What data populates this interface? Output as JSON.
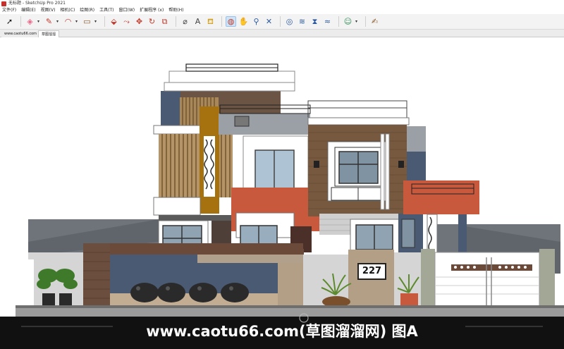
{
  "window": {
    "title": "无标题 - SketchUp Pro 2021"
  },
  "menu": {
    "items": [
      "文件(F)",
      "编辑(E)",
      "视图(V)",
      "相机(C)",
      "绘图(R)",
      "工具(T)",
      "窗口(W)",
      "扩展程序 (x)",
      "帮助(H)"
    ]
  },
  "toolbar": {
    "tools": [
      {
        "name": "select-icon",
        "glyph": "➚",
        "color": "#111111"
      },
      {
        "name": "eraser-icon",
        "glyph": "◈",
        "color": "#e86a8a"
      },
      {
        "name": "line-icon",
        "glyph": "✎",
        "color": "#c0392b"
      },
      {
        "name": "arc-icon",
        "glyph": "◠",
        "color": "#c0392b"
      },
      {
        "name": "rectangle-icon",
        "glyph": "▭",
        "color": "#8b5a2b"
      },
      {
        "name": "pushpull-icon",
        "glyph": "⬙",
        "color": "#c0392b"
      },
      {
        "name": "followme-icon",
        "glyph": "⤳",
        "color": "#c0392b"
      },
      {
        "name": "move-icon",
        "glyph": "✥",
        "color": "#c0392b"
      },
      {
        "name": "rotate-icon",
        "glyph": "↻",
        "color": "#c0392b"
      },
      {
        "name": "scale-icon",
        "glyph": "⧉",
        "color": "#c0392b"
      },
      {
        "name": "tape-measure-icon",
        "glyph": "⌀",
        "color": "#444444"
      },
      {
        "name": "text-icon",
        "glyph": "A",
        "color": "#444444"
      },
      {
        "name": "paint-bucket-icon",
        "glyph": "⛾",
        "color": "#d4a017"
      },
      {
        "name": "orbit-icon",
        "glyph": "◍",
        "color": "#c0392b"
      },
      {
        "name": "pan-icon",
        "glyph": "✋",
        "color": "#d4a017"
      },
      {
        "name": "zoom-icon",
        "glyph": "⚲",
        "color": "#2c5aa0"
      },
      {
        "name": "zoom-extents-icon",
        "glyph": "✕",
        "color": "#2c5aa0"
      },
      {
        "name": "warehouse-icon",
        "glyph": "◎",
        "color": "#2c5aa0"
      },
      {
        "name": "extension-warehouse-icon",
        "glyph": "≋",
        "color": "#2c5aa0"
      },
      {
        "name": "layout-icon",
        "glyph": "⧗",
        "color": "#2c5aa0"
      },
      {
        "name": "styles-icon",
        "glyph": "≈",
        "color": "#2c5aa0"
      },
      {
        "name": "account-icon",
        "glyph": "☺",
        "color": "#2e8b57"
      },
      {
        "name": "scene-note-icon",
        "glyph": "✍",
        "color": "#8b5a2b"
      }
    ]
  },
  "tabs": [
    {
      "label": "www.caotu66.com"
    },
    {
      "label": "草图溜溜"
    }
  ],
  "model": {
    "house_number": "227"
  },
  "watermark": {
    "text": "www.caotu66.com(草图溜溜网) 图A"
  }
}
